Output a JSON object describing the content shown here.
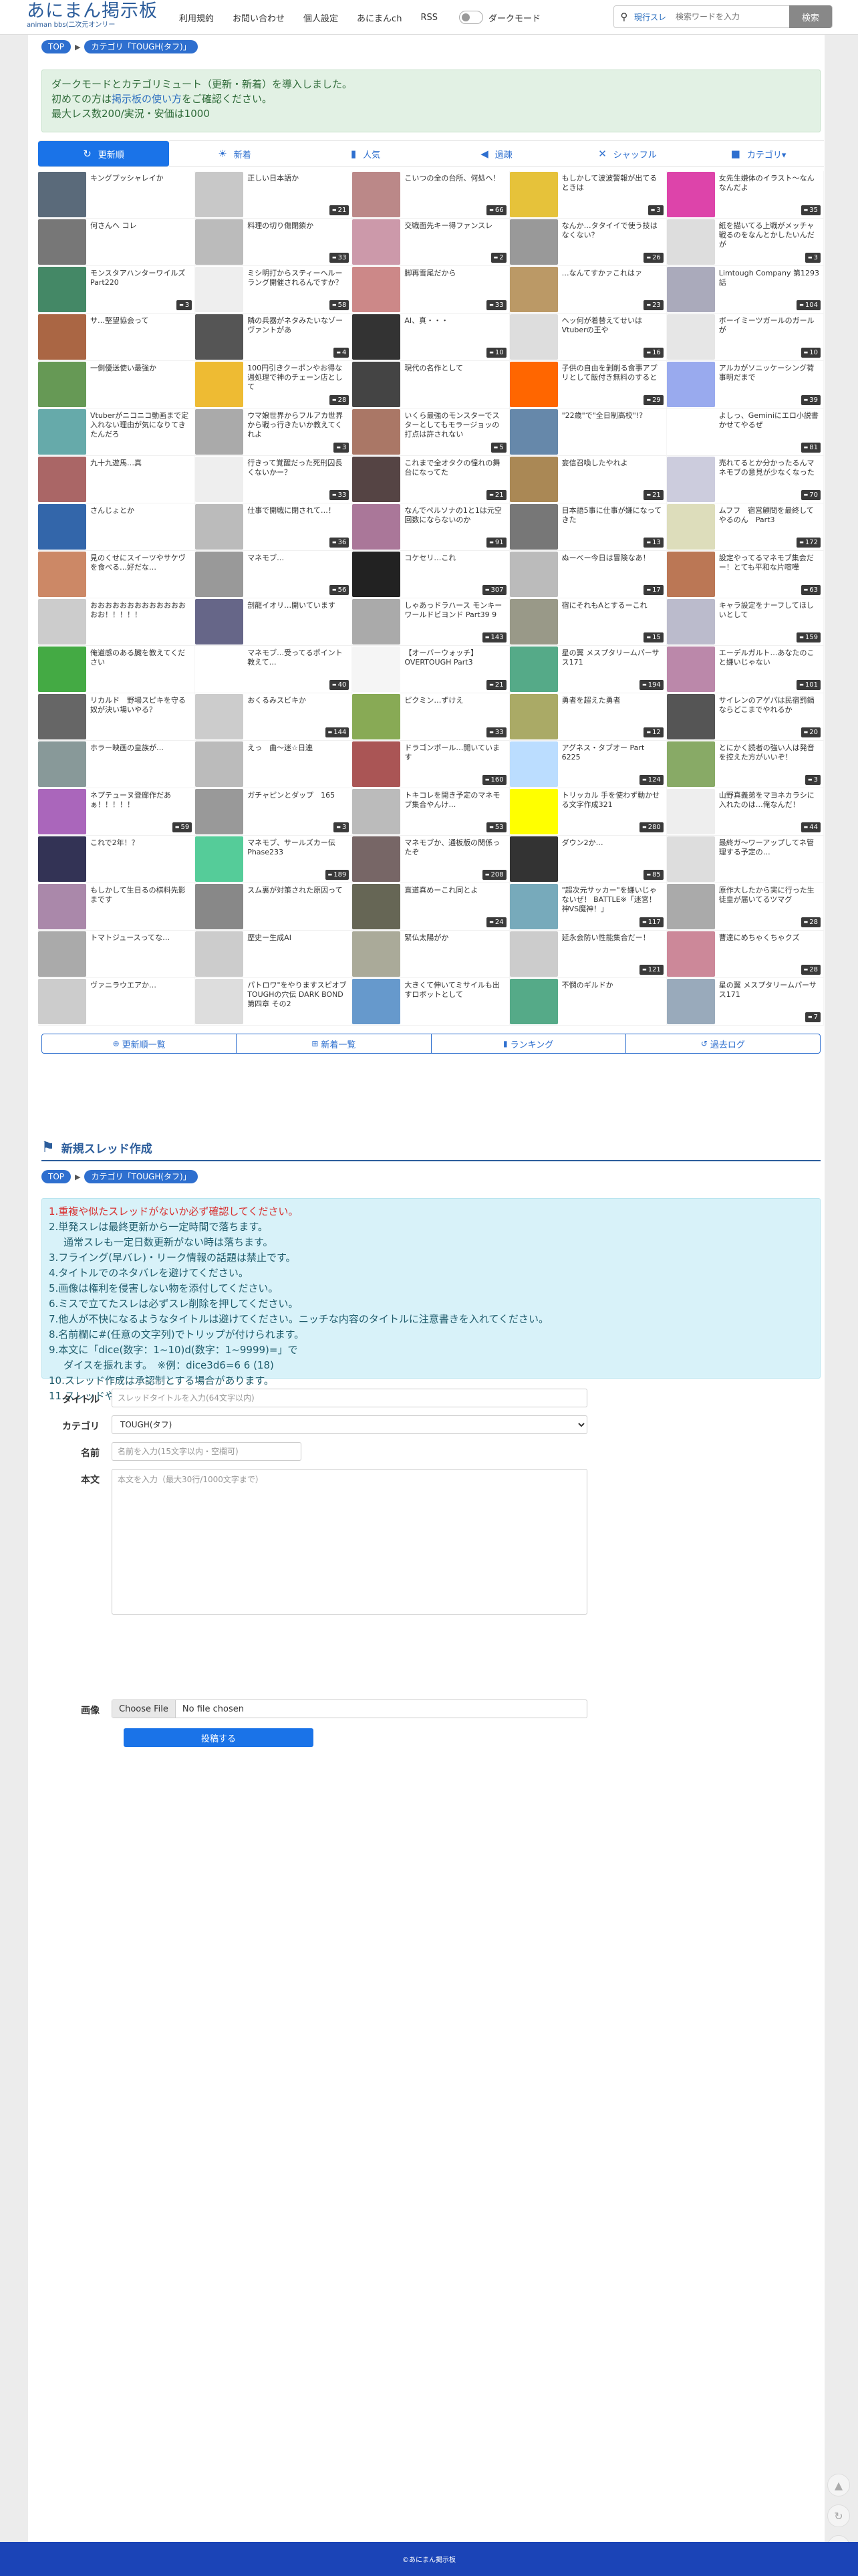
{
  "header": {
    "logo_title": "あにまん掲示板",
    "logo_sub": "animan bbs(二次元オンリー",
    "nav": [
      "利用規約",
      "お問い合わせ",
      "個人設定",
      "あにまんch",
      "RSS"
    ],
    "dark_label": "ダークモード",
    "search_mode": "現行スレ",
    "search_placeholder": "検索ワードを入力",
    "search_button": "検索"
  },
  "breadcrumb": {
    "top": "TOP",
    "category": "カテゴリ「TOUGH(タフ)」"
  },
  "notice": {
    "line1": "ダークモードとカテゴリミュート（更新・新着）を導入しました。",
    "line2_pre": "初めての方は",
    "line2_link": "掲示板の使い方",
    "line2_post": "をご確認ください。",
    "line3": "最大レス数200/実況・安価は1000"
  },
  "tabs": [
    {
      "icon": "↻",
      "label": "更新順"
    },
    {
      "icon": "☀",
      "label": "新着"
    },
    {
      "icon": "▮",
      "label": "人気"
    },
    {
      "icon": "◀",
      "label": "過疎"
    },
    {
      "icon": "✕",
      "label": "シャッフル"
    },
    {
      "icon": "■",
      "label": "カテゴリ▾"
    }
  ],
  "threads": [
    {
      "t": "キングプッシャレイか",
      "c": "",
      "col": "#5a6a7a"
    },
    {
      "t": "正しい日本語か",
      "c": "21",
      "col": "#c8c8c8"
    },
    {
      "t": "こいつの全の台所、何処へ！",
      "c": "66",
      "col": "#b88",
      "note": ""
    },
    {
      "t": "もしかして波波警報が出てるときは",
      "c": "3",
      "col": "#e6c23a"
    },
    {
      "t": "女先生嫌体のイラスト〜なんなんだよ",
      "c": "35",
      "col": "#d4a"
    },
    {
      "t": "何さんへ コレ",
      "c": "",
      "col": "#777"
    },
    {
      "t": "料理の切り傷閉鎖か",
      "c": "33",
      "col": "#bbb"
    },
    {
      "t": "交戦面先キー得ファンスレ",
      "c": "2",
      "col": "#c9a"
    },
    {
      "t": "なんか…タタイイで使う技はなくない？",
      "c": "26",
      "col": "#999"
    },
    {
      "t": "紙を描いてる上戦がメッチャ戦るのをなんとかしたいんだが",
      "c": "3",
      "col": "#ddd"
    },
    {
      "t": "モンスタアハンターワイルズ Part220",
      "c": "3",
      "col": "#486"
    },
    {
      "t": "ミシ明打からスティーヘルーラング開催されるんですか？",
      "c": "58",
      "col": "#eee"
    },
    {
      "t": "脚再雪尾だから",
      "c": "33",
      "col": "#c88"
    },
    {
      "t": "…なんてすかァこれはァ",
      "c": "23",
      "col": "#b96"
    },
    {
      "t": "Limtough Company 第1293話",
      "c": "104",
      "col": "#aab"
    },
    {
      "t": "サ…堅望協会って",
      "c": "",
      "col": "#a64"
    },
    {
      "t": "隣の兵器がネタみたいなゾーヴァントがあ",
      "c": "4",
      "col": "#555"
    },
    {
      "t": "AI、真・・・",
      "c": "10",
      "col": "#333"
    },
    {
      "t": "ヘッ何が着替えてせいはVtuberの王や",
      "c": "16",
      "col": "#ddd"
    },
    {
      "t": "ボーイミーツガールのガールが",
      "c": "10",
      "col": "#e6e6e6"
    },
    {
      "t": "一側優送使い最強か",
      "c": "",
      "col": "#695"
    },
    {
      "t": "100円引きクーポンやお得な週処理で神のチェーン店として",
      "c": "28",
      "col": "#eb3"
    },
    {
      "t": "現代の名作として",
      "c": "",
      "col": "#444"
    },
    {
      "t": "子供の自由を剝削る食事アプリとして飯付き無料のすると",
      "c": "29",
      "col": "#f60"
    },
    {
      "t": "アルカがソニッケーシング荷事明だまで",
      "c": "39",
      "col": "#9ae"
    },
    {
      "t": "Vtuberがニコニコ動画まで定入れない理由が気になりてきたんだろ",
      "c": "",
      "col": "#6aa"
    },
    {
      "t": "ウマ娘世界からフルアカ世界から戦っ行きたいか教えてくれよ",
      "c": "3",
      "col": "#aaa"
    },
    {
      "t": "いくら最強のモンスターでスターとしてもモラージョッの打点は許されない",
      "c": "5",
      "col": "#a76"
    },
    {
      "t": "\"22歳\"で\"全日制高校\"!?",
      "c": "",
      "col": "#68a"
    },
    {
      "t": "よしっ、Geminiにエロ小説書かせてやるぜ",
      "c": "81",
      "col": "#fff"
    },
    {
      "t": "九十九遊馬…真",
      "c": "",
      "col": "#a66"
    },
    {
      "t": "行きって覚醒だった死刑囚長くないかー？",
      "c": "33",
      "col": "#eee"
    },
    {
      "t": "これまで全オタクの憧れの舞台になってた",
      "c": "21",
      "col": "#544"
    },
    {
      "t": "妄信召喚したやれよ",
      "c": "21",
      "col": "#a85"
    },
    {
      "t": "売れてるとか分かったるんマネモブの意見が少なくなった",
      "c": "70",
      "col": "#ccd"
    },
    {
      "t": "さんじょとか",
      "c": "",
      "col": "#36a"
    },
    {
      "t": "仕事で開戦に閉されて…！",
      "c": "36",
      "col": "#bbb"
    },
    {
      "t": "なんでペルソナの1と1は元空回数にならないのか",
      "c": "91",
      "col": "#a79"
    },
    {
      "t": "日本語5事に仕事が嫌になってきた",
      "c": "13",
      "col": "#777"
    },
    {
      "t": "ムフフ　宿営顧問を最終してやるのん　Part3",
      "c": "172",
      "col": "#ddb"
    },
    {
      "t": "見のくせにスイーツやサケヴを食べる…好だな…",
      "c": "",
      "col": "#c86"
    },
    {
      "t": "マネモブ…",
      "c": "56",
      "col": "#999"
    },
    {
      "t": "コケセリ…これ",
      "c": "307",
      "col": "#222"
    },
    {
      "t": "ぬーべー今日は冒険なあ！",
      "c": "17",
      "col": "#bbb"
    },
    {
      "t": "設定やってるマネモブ集会だー！とても平和な片喧嘩",
      "c": "63",
      "col": "#b75"
    },
    {
      "t": "おおおおおおおおおおおおおおお！！！！！",
      "c": "",
      "col": "#ccc"
    },
    {
      "t": "剖龍イオリ…開いています",
      "c": "",
      "col": "#668"
    },
    {
      "t": "しゃあっドラハース モンキーワールドビヨンド Part39 9",
      "c": "143",
      "col": "#aaa"
    },
    {
      "t": "宿にそれもAとするーこれ",
      "c": "15",
      "col": "#998"
    },
    {
      "t": "キャラ設定をナーフしてほしいとして",
      "c": "159",
      "col": "#bbc"
    },
    {
      "t": "俺道感のある臓を教えてください",
      "c": "",
      "col": "#4a4"
    },
    {
      "t": "マネモブ…受ってるポイント教えて…",
      "c": "40",
      "col": "#fff"
    },
    {
      "t": "【オーバーウォッチ】OVERTOUGH Part3",
      "c": "21",
      "col": "#f5f5f5"
    },
    {
      "t": "星の翼 メスプタリームパーサス171",
      "c": "194",
      "col": "#5a8"
    },
    {
      "t": "エーデルガルト…あなたのこと嫌いじゃない",
      "c": "101",
      "col": "#b8a"
    },
    {
      "t": "リカルド　野場スピキを守る奴が決い場いやる？",
      "c": "",
      "col": "#666"
    },
    {
      "t": "おくるみスビキか",
      "c": "144",
      "col": "#ccc"
    },
    {
      "t": "ピクミン…ずけえ",
      "c": "33",
      "col": "#8a5"
    },
    {
      "t": "勇者を超えた勇者",
      "c": "12",
      "col": "#aa6"
    },
    {
      "t": "サイレンのアゲパは民宿罰鍋ならどこまでやれるか",
      "c": "20",
      "col": "#555"
    },
    {
      "t": "ホラー映画の皇族が…",
      "c": "",
      "col": "#899"
    },
    {
      "t": "えっ　曲〜迷☆日連",
      "c": "",
      "col": "#bbb"
    },
    {
      "t": "ドラゴンボール…開いています",
      "c": "160",
      "col": "#a55"
    },
    {
      "t": "アグネス・タブオー Part 6225",
      "c": "124",
      "col": "#bdf"
    },
    {
      "t": "とにかく読者の強い人は発音を控えた方がいいぞ！",
      "c": "3",
      "col": "#8a6"
    },
    {
      "t": "ネプテューヌ登廊作だあぁ！！！！！",
      "c": "59",
      "col": "#a6b"
    },
    {
      "t": "ガチャピンとダップ　165",
      "c": "3",
      "col": "#999"
    },
    {
      "t": "トキコレを開き予定のマネモブ集合やんけ…",
      "c": "53",
      "col": "#bbb"
    },
    {
      "t": "トリッカル 手を使わず動かせる文字作成321",
      "c": "280",
      "col": "#ff0"
    },
    {
      "t": "山野真義弟をマヨネカラシに入れたのは…俺なんだ！",
      "c": "44",
      "col": "#eee"
    },
    {
      "t": "これで2年！？",
      "c": "",
      "col": "#335"
    },
    {
      "t": "マネモブ、サールズカー伝Phase233",
      "c": "189",
      "col": "#5c9"
    },
    {
      "t": "マネモブか、通板版の関係ったぞ",
      "c": "208",
      "col": "#766"
    },
    {
      "t": "ダウン2か…",
      "c": "85",
      "col": "#333"
    },
    {
      "t": "最終ガ〜ワーアップしてネ管理する予定の…",
      "c": "",
      "col": "#ddd"
    },
    {
      "t": "もしかして生日るの棋料先影まです",
      "c": "",
      "col": "#a8a"
    },
    {
      "t": "スム裏が対策された原因って",
      "c": "",
      "col": "#888"
    },
    {
      "t": "直道真めーこれ同とよ",
      "c": "24",
      "col": "#665"
    },
    {
      "t": "\"超次元サッカー\"を嫌いじゃないぜ！ BATTLE※「迷宮！神VS魔神！」",
      "c": "117",
      "col": "#7ab"
    },
    {
      "t": "原作大したから実に行った生徒皇が届いてるツマグ",
      "c": "28",
      "col": "#aaa"
    },
    {
      "t": "トマトジュースってな…",
      "c": "",
      "col": "#aaa"
    },
    {
      "t": "歴史ー生成AI",
      "c": "",
      "col": "#ccc"
    },
    {
      "t": "緊仏太陽がか",
      "c": "",
      "col": "#aa9"
    },
    {
      "t": "延永会防い性能集合だー！",
      "c": "121",
      "col": "#ccc"
    },
    {
      "t": "曹達にめちゃくちゃクズ",
      "c": "28",
      "col": "#c89"
    },
    {
      "t": "ヴァニラウエアか…",
      "c": "",
      "col": "#ccc"
    },
    {
      "t": "パトロワ\"をやりますスピオブ TOUGHの穴伝 DARK BOND 第四章 その2",
      "c": "",
      "col": "#ddd"
    },
    {
      "t": "大きくて伸いてミサイルも出すロボットとして",
      "c": "",
      "col": "#69c"
    },
    {
      "t": "不憫のギルドか",
      "c": "",
      "col": "#5a8"
    },
    {
      "t": "星の翼 メスプタリームパーサス171",
      "c": "7",
      "col": "#9ab"
    }
  ],
  "bottomnav": [
    {
      "icon": "⊕",
      "label": "更新順一覧"
    },
    {
      "icon": "⊞",
      "label": "新着一覧"
    },
    {
      "icon": "▮",
      "label": "ランキング"
    },
    {
      "icon": "↺",
      "label": "過去ログ"
    }
  ],
  "newthread": {
    "heading": "新規スレッド作成",
    "rules": [
      "1.重複や似たスレッドがないか必ず確認してください。",
      "2.単発スレは最終更新から一定時間で落ちます。",
      "通常スレも一定日数更新がない時は落ちます。",
      "3.フライング(早バレ)・リーク情報の話題は禁止です。",
      "4.タイトルでのネタバレを避けてください。",
      "5.画像は権利を侵害しない物を添付してください。",
      "6.ミスで立てたスレは必ずスレ削除を押してください。",
      "7.他人が不快になるようなタイトルは避けてください。ニッチな内容のタイトルに注意書きを入れてください。",
      "8.名前欄に#(任意の文字列)でトリップが付けられます。",
      "9.本文に「dice(数字：1~10)d(数字：1~9999)=」で",
      "ダイスを振れます。　※例：dice3d6=6 6 (18)",
      "10.スレッド作成は承認制とする場合があります。",
      "11.スレッドやレスの削除は落ちてから10日間経つと操作できなくなります。"
    ],
    "form": {
      "title_label": "タイトル",
      "title_placeholder": "スレッドタイトルを入力(64文字以内)",
      "category_label": "カテゴリ",
      "category_value": "TOUGH(タフ)",
      "name_label": "名前",
      "name_placeholder": "名前を入力(15文字以内・空欄可)",
      "body_label": "本文",
      "body_placeholder": "本文を入力（最大30行/1000文字まで）",
      "image_label": "画像",
      "file_button": "Choose File",
      "file_name": "No file chosen",
      "submit": "投稿する"
    }
  },
  "footer": "©あにまん掲示板"
}
